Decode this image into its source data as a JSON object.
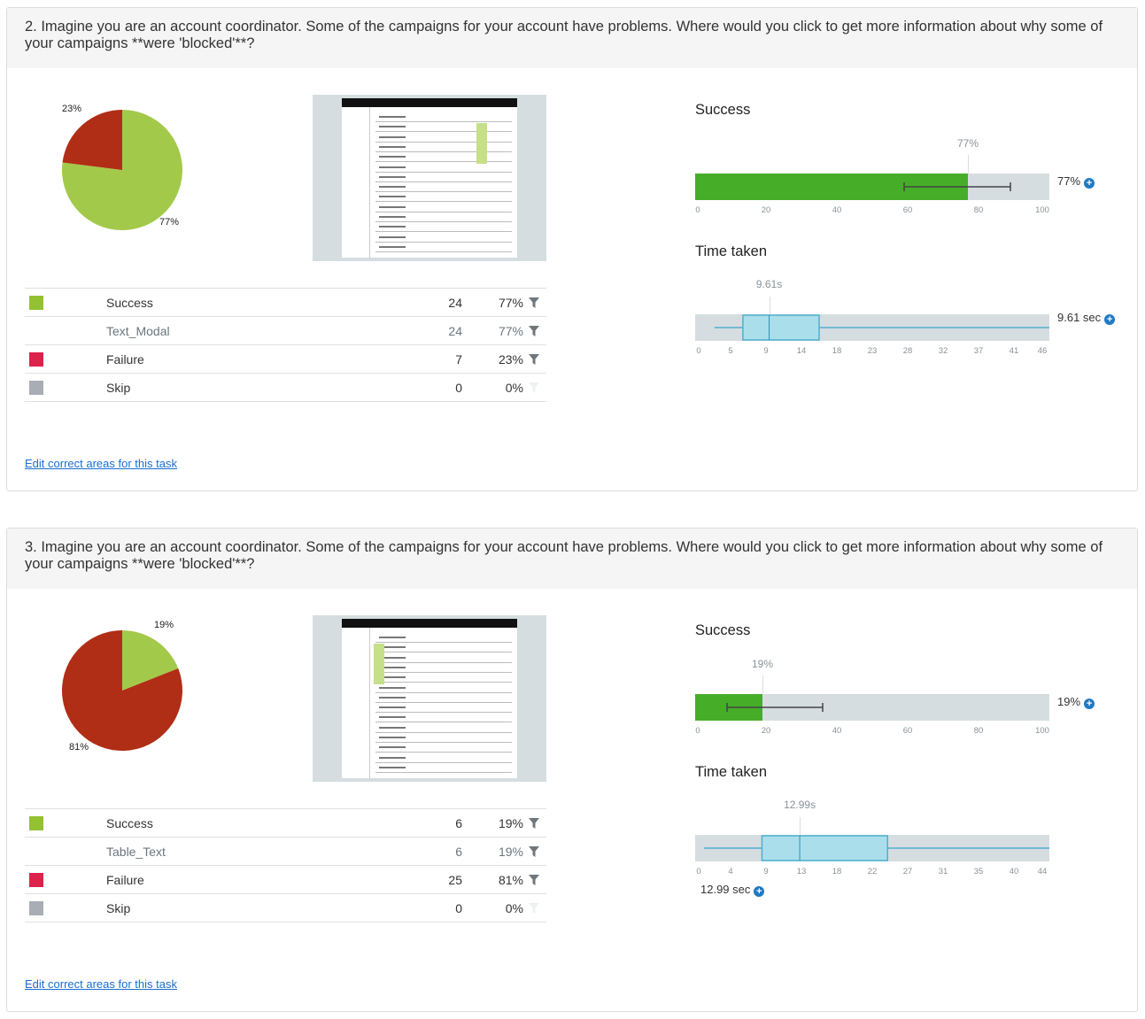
{
  "colors": {
    "success": "#94c132",
    "failure": "#dc234b",
    "skip": "#a8aeb3",
    "pie_success": "#a3c94a",
    "pie_failure": "#b02d16",
    "bar_fill": "#46ad29",
    "box_fill": "#abdeeb",
    "box_stroke": "#4fb0cf",
    "link": "#1a6fd1"
  },
  "tasks": [
    {
      "question": "2. Imagine you are an account coordinator. Some of the campaigns for your account have problems. Where would you click to get more information about why some of your campaigns **were 'blocked'**?",
      "pie": {
        "success_pct": 77,
        "failure_pct": 23,
        "success_label": "77%",
        "failure_label": "23%"
      },
      "rows": [
        {
          "label": "Success",
          "count": "24",
          "pct": "77%",
          "swatch": "success",
          "filter": true
        },
        {
          "label": "Text_Modal",
          "count": "24",
          "pct": "77%",
          "swatch": null,
          "filter": true,
          "sub": true
        },
        {
          "label": "Failure",
          "count": "7",
          "pct": "23%",
          "swatch": "failure",
          "filter": true
        },
        {
          "label": "Skip",
          "count": "0",
          "pct": "0%",
          "swatch": "skip",
          "filter": false
        }
      ],
      "edit_link": "Edit correct areas for this task",
      "success": {
        "title": "Success",
        "value": 77,
        "marker_label": "77%",
        "value_label": "77%",
        "ci": [
          59,
          89
        ],
        "ticks": [
          "0",
          "20",
          "40",
          "60",
          "80",
          "100"
        ]
      },
      "time": {
        "title": "Time taken",
        "min": 2.5,
        "q1": 6.2,
        "median": 9.61,
        "q3": 16.1,
        "max": 46,
        "axis_max": 46,
        "marker_label": "9.61s",
        "value_label": "9.61 sec",
        "ticks": [
          "0",
          "5",
          "9",
          "14",
          "18",
          "23",
          "28",
          "32",
          "37",
          "41",
          "46"
        ],
        "value_below": false
      }
    },
    {
      "question": "3. Imagine you are an account coordinator. Some of the campaigns for your account have problems. Where would you click to get more information about why some of your campaigns **were 'blocked'**?",
      "pie": {
        "success_pct": 19,
        "failure_pct": 81,
        "success_label": "19%",
        "failure_label": "81%"
      },
      "rows": [
        {
          "label": "Success",
          "count": "6",
          "pct": "19%",
          "swatch": "success",
          "filter": true
        },
        {
          "label": "Table_Text",
          "count": "6",
          "pct": "19%",
          "swatch": null,
          "filter": true,
          "sub": true
        },
        {
          "label": "Failure",
          "count": "25",
          "pct": "81%",
          "swatch": "failure",
          "filter": true
        },
        {
          "label": "Skip",
          "count": "0",
          "pct": "0%",
          "swatch": "skip",
          "filter": false
        }
      ],
      "edit_link": "Edit correct areas for this task",
      "success": {
        "title": "Success",
        "value": 19,
        "marker_label": "19%",
        "value_label": "19%",
        "ci": [
          9,
          36
        ],
        "ticks": [
          "0",
          "20",
          "40",
          "60",
          "80",
          "100"
        ]
      },
      "time": {
        "title": "Time taken",
        "min": 1.1,
        "q1": 8.3,
        "median": 12.99,
        "q3": 23.9,
        "max": 44,
        "axis_max": 44,
        "marker_label": "12.99s",
        "value_label": "12.99 sec",
        "ticks": [
          "0",
          "4",
          "9",
          "13",
          "18",
          "22",
          "27",
          "31",
          "35",
          "40",
          "44"
        ],
        "value_below": true
      }
    }
  ]
}
